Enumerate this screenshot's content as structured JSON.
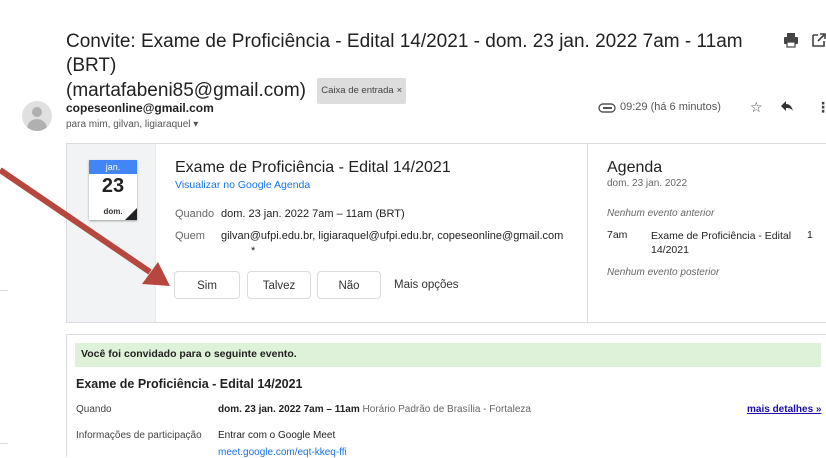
{
  "header": {
    "subject": "Convite: Exame de Proficiência - Edital 14/2021 - dom. 23 jan. 2022 7am - 11am (BRT)",
    "subject_email": "(martafabeni85@gmail.com)",
    "label": "Caixa de entrada",
    "label_close": "×",
    "print_icon": "print-icon",
    "open_new_icon": "open-in-new-icon"
  },
  "message": {
    "sender": "copeseonline@gmail.com",
    "recipients": "para mim, gilvan, ligiaraquel ▾",
    "time": "09:29 (há 6 minutos)"
  },
  "event_card": {
    "cal_month": "jan.",
    "cal_day": "23",
    "cal_weekday": "dom.",
    "title": "Exame de Proficiência - Edital 14/2021",
    "view_link": "Visualizar no Google Agenda",
    "when_label": "Quando",
    "when_value": "dom. 23 jan. 2022 7am – 11am (BRT)",
    "who_label": "Quem",
    "who_value": "gilvan@ufpi.edu.br, ligiaraquel@ufpi.edu.br, copeseonline@gmail.com",
    "who_more": "*",
    "rsvp_yes": "Sim",
    "rsvp_maybe": "Talvez",
    "rsvp_no": "Não",
    "more_options": "Mais opções"
  },
  "agenda": {
    "title": "Agenda",
    "date": "dom. 23 jan. 2022",
    "no_prev": "Nenhum evento anterior",
    "event_time": "7am",
    "event_title": "Exame de Proficiência - Edital 14/2021",
    "event_count": "1",
    "no_next": "Nenhum evento posterior"
  },
  "invitation": {
    "banner": "Você foi convidado para o seguinte evento.",
    "title": "Exame de Proficiência - Edital 14/2021",
    "when_label": "Quando",
    "when_value": "dom. 23 jan. 2022 7am – 11am",
    "when_tz": "Horário Padrão de Brasília - Fortaleza",
    "more_details": "mais detalhes »",
    "join_label": "Informações de participação",
    "join_value": "Entrar com o Google Meet",
    "meet_link": "meet.google.com/eqt-kkeq-ffi"
  },
  "colors": {
    "annotation_arrow": "#b5473f",
    "calendar_blue": "#4285f4",
    "banner_green": "#ddf2d8",
    "link_blue": "#1a73e8"
  }
}
